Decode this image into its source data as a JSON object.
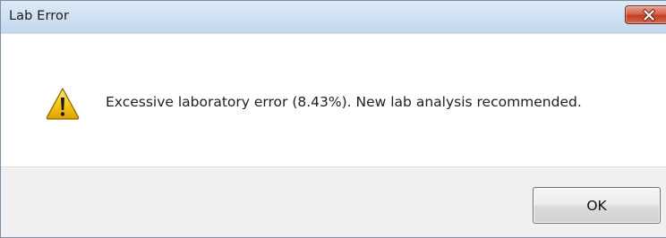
{
  "window": {
    "title": "Lab Error"
  },
  "icons": {
    "title_close": "close-icon",
    "message_icon": "warning-icon"
  },
  "message": {
    "text": "Excessive laboratory error (8.43%). New lab analysis recommended."
  },
  "buttons": {
    "ok_label": "OK"
  },
  "colors": {
    "titlebar": "#cfe0f2",
    "close_button": "#c23d22",
    "footer": "#f0f0f0",
    "warning_yellow": "#f5c518"
  }
}
